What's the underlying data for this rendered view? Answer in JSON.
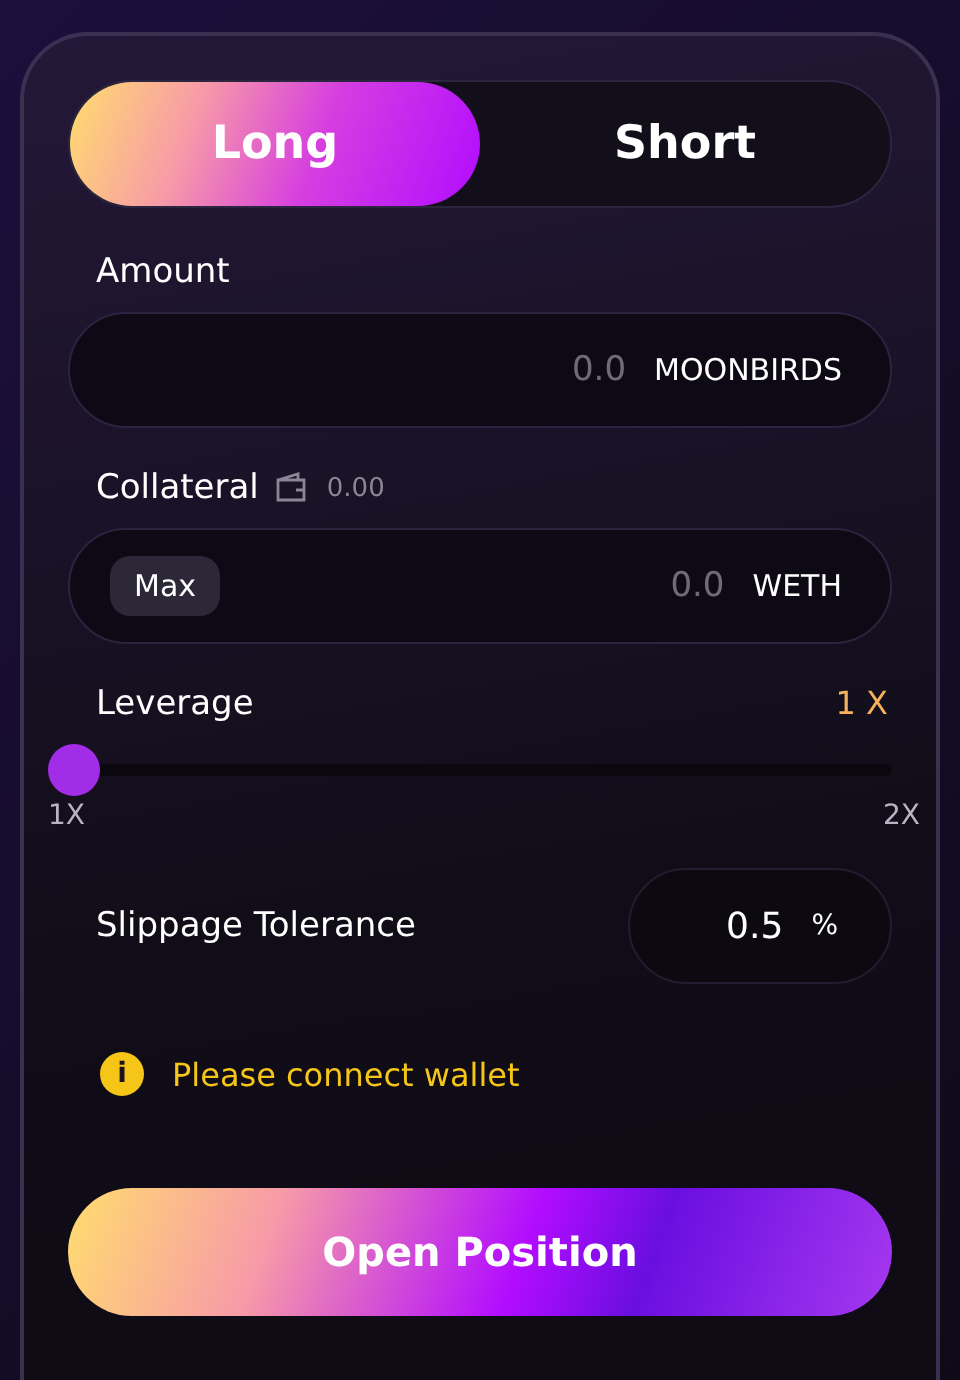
{
  "tabs": [
    {
      "label": "Long",
      "selected": true
    },
    {
      "label": "Short",
      "selected": false
    }
  ],
  "amount": {
    "label": "Amount",
    "placeholder": "0.0",
    "unit": "MOONBIRDS"
  },
  "collateral": {
    "label": "Collateral",
    "balance": "0.00",
    "max_button": "Max",
    "placeholder": "0.0",
    "unit": "WETH"
  },
  "leverage": {
    "label": "Leverage",
    "value": "1 X",
    "level": 0,
    "min_label": "1X",
    "max_label": "2X"
  },
  "slippage": {
    "label": "Slippage Tolerance",
    "value": "0.5",
    "unit": "%"
  },
  "warning": {
    "icon": "i",
    "text": "Please connect wallet"
  },
  "submit": "Open Position"
}
